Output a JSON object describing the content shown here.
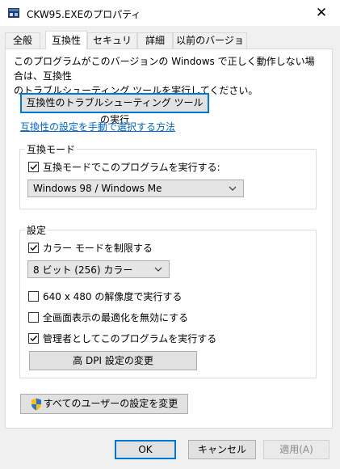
{
  "window": {
    "title": "CKW95.EXEのプロパティ",
    "close_glyph": "✕"
  },
  "tabs": [
    {
      "label": "全般",
      "active": false
    },
    {
      "label": "互換性",
      "active": true
    },
    {
      "label": "セキュリティ",
      "active": false
    },
    {
      "label": "詳細",
      "active": false
    },
    {
      "label": "以前のバージョン",
      "active": false
    }
  ],
  "intro": {
    "line1": "このプログラムがこのバージョンの Windows で正しく動作しない場合は、互換性",
    "line2": "のトラブルシューティング ツールを実行してください。"
  },
  "troubleshooter_button": "互換性のトラブルシューティング ツールの実行",
  "manual_link": "互換性の設定を手動で選択する方法",
  "compat_mode": {
    "group_title": "互換モード",
    "checkbox_label": "互換モードでこのプログラムを実行する:",
    "checked": true,
    "selected_os": "Windows 98 / Windows Me"
  },
  "settings": {
    "group_title": "設定",
    "color_mode_label": "カラー モードを制限する",
    "color_mode_checked": true,
    "color_select": "8 ビット (256) カラー",
    "res_label": "640 x 480 の解像度で実行する",
    "res_checked": false,
    "fullscreen_label": "全画面表示の最適化を無効にする",
    "fullscreen_checked": false,
    "admin_label": "管理者としてこのプログラムを実行する",
    "admin_checked": true,
    "dpi_button": "高 DPI 設定の変更"
  },
  "all_users_button": "すべてのユーザーの設定を変更",
  "footer": {
    "ok": "OK",
    "cancel": "キャンセル",
    "apply": "適用(A)"
  },
  "colors": {
    "accent": "#0078d7",
    "link": "#0066cc",
    "disabled_text": "#8a8a8a"
  }
}
